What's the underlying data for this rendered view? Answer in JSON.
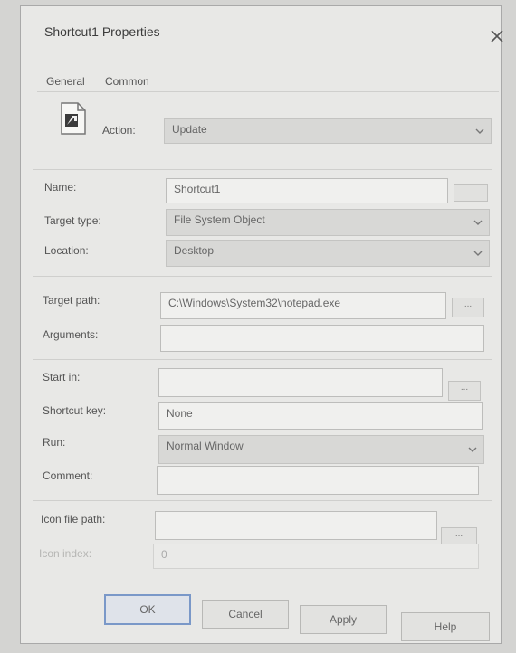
{
  "window": {
    "title": "Shortcut1 Properties"
  },
  "tabs": {
    "general": "General",
    "common": "Common"
  },
  "action": {
    "label": "Action:",
    "value": "Update"
  },
  "name": {
    "label": "Name:",
    "value": "Shortcut1"
  },
  "target_type": {
    "label": "Target type:",
    "value": "File System Object"
  },
  "location": {
    "label": "Location:",
    "value": "Desktop"
  },
  "target_path": {
    "label": "Target path:",
    "value": "C:\\Windows\\System32\\notepad.exe",
    "browse": "..."
  },
  "arguments": {
    "label": "Arguments:",
    "value": ""
  },
  "start_in": {
    "label": "Start in:",
    "value": "",
    "browse": "..."
  },
  "shortcut_key": {
    "label": "Shortcut key:",
    "value": "None"
  },
  "run": {
    "label": "Run:",
    "value": "Normal Window"
  },
  "comment": {
    "label": "Comment:",
    "value": ""
  },
  "icon_file_path": {
    "label": "Icon file path:",
    "value": "",
    "browse": "..."
  },
  "icon_index": {
    "label": "Icon index:",
    "value": "0"
  },
  "buttons": {
    "ok": "OK",
    "cancel": "Cancel",
    "apply": "Apply",
    "help": "Help"
  },
  "icons": {
    "shortcut": "shortcut-file-icon",
    "chevron": "chevron-down-icon",
    "close": "close-icon"
  }
}
